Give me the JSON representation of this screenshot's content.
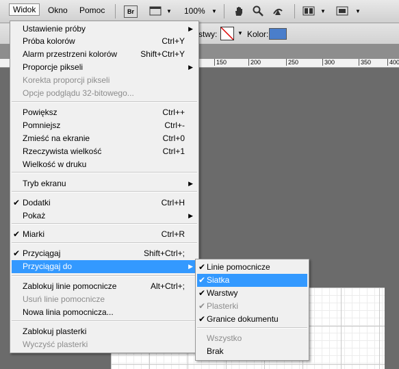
{
  "menubar": {
    "items": [
      "Widok",
      "Okno",
      "Pomoc"
    ],
    "bridge_label": "Br",
    "zoom": "100%"
  },
  "optbar": {
    "layers_label": "rstwy:",
    "color_label": "Kolor:",
    "color_swatch": "#4a7ecb"
  },
  "ruler": {
    "ticks": [
      "150",
      "200",
      "250",
      "300",
      "350",
      "400"
    ]
  },
  "view_menu": {
    "items": [
      {
        "label": "Ustawienie próby",
        "shortcut": "",
        "submenu": true,
        "checked": false,
        "disabled": false
      },
      {
        "label": "Próba kolorów",
        "shortcut": "Ctrl+Y",
        "submenu": false,
        "checked": false,
        "disabled": false
      },
      {
        "label": "Alarm przestrzeni kolorów",
        "shortcut": "Shift+Ctrl+Y",
        "submenu": false,
        "checked": false,
        "disabled": false
      },
      {
        "label": "Proporcje pikseli",
        "shortcut": "",
        "submenu": true,
        "checked": false,
        "disabled": false
      },
      {
        "label": "Korekta proporcji pikseli",
        "shortcut": "",
        "submenu": false,
        "checked": false,
        "disabled": true
      },
      {
        "label": "Opcje podglądu 32-bitowego...",
        "shortcut": "",
        "submenu": false,
        "checked": false,
        "disabled": true
      },
      {
        "label": "Powiększ",
        "shortcut": "Ctrl++",
        "submenu": false,
        "checked": false,
        "disabled": false
      },
      {
        "label": "Pomniejsz",
        "shortcut": "Ctrl+-",
        "submenu": false,
        "checked": false,
        "disabled": false
      },
      {
        "label": "Zmieść na ekranie",
        "shortcut": "Ctrl+0",
        "submenu": false,
        "checked": false,
        "disabled": false
      },
      {
        "label": "Rzeczywista wielkość",
        "shortcut": "Ctrl+1",
        "submenu": false,
        "checked": false,
        "disabled": false
      },
      {
        "label": "Wielkość w druku",
        "shortcut": "",
        "submenu": false,
        "checked": false,
        "disabled": false
      },
      {
        "label": "Tryb ekranu",
        "shortcut": "",
        "submenu": true,
        "checked": false,
        "disabled": false
      },
      {
        "label": "Dodatki",
        "shortcut": "Ctrl+H",
        "submenu": false,
        "checked": true,
        "disabled": false
      },
      {
        "label": "Pokaż",
        "shortcut": "",
        "submenu": true,
        "checked": false,
        "disabled": false
      },
      {
        "label": "Miarki",
        "shortcut": "Ctrl+R",
        "submenu": false,
        "checked": true,
        "disabled": false
      },
      {
        "label": "Przyciągaj",
        "shortcut": "Shift+Ctrl+;",
        "submenu": false,
        "checked": true,
        "disabled": false
      },
      {
        "label": "Przyciągaj do",
        "shortcut": "",
        "submenu": true,
        "checked": false,
        "disabled": false,
        "highlighted": true
      },
      {
        "label": "Zablokuj linie pomocnicze",
        "shortcut": "Alt+Ctrl+;",
        "submenu": false,
        "checked": false,
        "disabled": false
      },
      {
        "label": "Usuń linie pomocnicze",
        "shortcut": "",
        "submenu": false,
        "checked": false,
        "disabled": true
      },
      {
        "label": "Nowa linia pomocnicza...",
        "shortcut": "",
        "submenu": false,
        "checked": false,
        "disabled": false
      },
      {
        "label": "Zablokuj plasterki",
        "shortcut": "",
        "submenu": false,
        "checked": false,
        "disabled": false
      },
      {
        "label": "Wyczyść plasterki",
        "shortcut": "",
        "submenu": false,
        "checked": false,
        "disabled": true
      }
    ]
  },
  "snap_submenu": {
    "items": [
      {
        "label": "Linie pomocnicze",
        "checked": true,
        "disabled": false
      },
      {
        "label": "Siatka",
        "checked": true,
        "disabled": false,
        "highlighted": true
      },
      {
        "label": "Warstwy",
        "checked": true,
        "disabled": false
      },
      {
        "label": "Plasterki",
        "checked": true,
        "disabled": true
      },
      {
        "label": "Granice dokumentu",
        "checked": true,
        "disabled": false
      },
      {
        "label": "Wszystko",
        "checked": false,
        "disabled": true
      },
      {
        "label": "Brak",
        "checked": false,
        "disabled": false
      }
    ]
  },
  "icons": {
    "check": "✔",
    "arrow": "▶"
  }
}
